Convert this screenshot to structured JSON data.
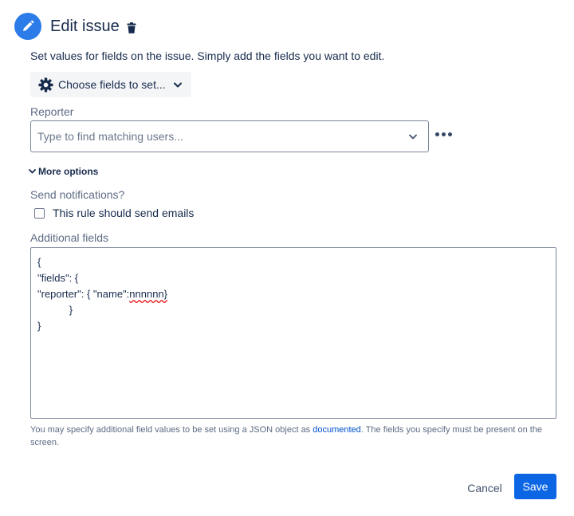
{
  "header": {
    "title": "Edit issue",
    "icon": "pencil-icon",
    "delete_icon": "trash-icon",
    "accent_color": "#2b7be9"
  },
  "description": "Set values for fields on the issue. Simply add the fields you want to edit.",
  "choose_fields": {
    "label": "Choose fields to set...",
    "icon": "gear-icon"
  },
  "reporter": {
    "label": "Reporter",
    "placeholder": "Type to find matching users..."
  },
  "more_options": {
    "label": "More options"
  },
  "notifications": {
    "label": "Send notifications?",
    "checkbox_label": "This rule should send emails",
    "checked": false
  },
  "additional_fields": {
    "label": "Additional fields",
    "json_lines": [
      "{",
      "\"fields\": {",
      "\"reporter\": { \"name\":",
      "nnnnnn}",
      "           }",
      "}"
    ],
    "help_text_before": "You may specify additional field values to be set using a JSON object as ",
    "help_link": "documented",
    "help_text_after": ". The fields you specify must be present on the screen."
  },
  "footer": {
    "cancel_label": "Cancel",
    "save_label": "Save",
    "save_color": "#0c66e4"
  }
}
